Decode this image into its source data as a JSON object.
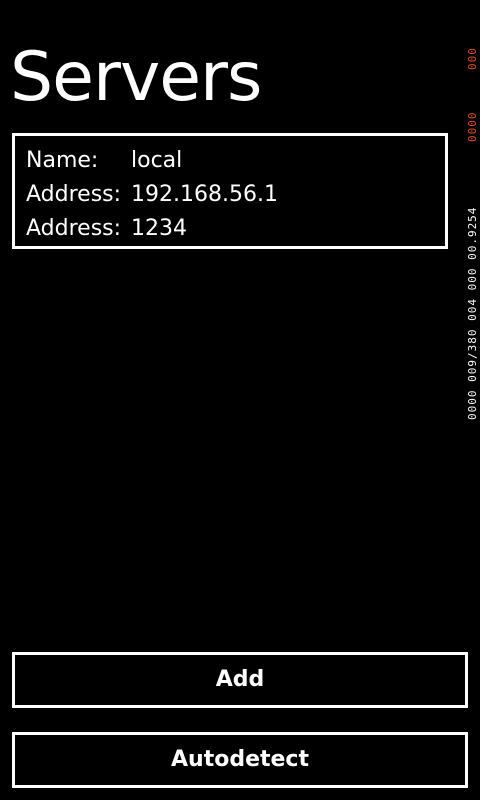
{
  "header": {
    "title": "Servers"
  },
  "servers": [
    {
      "rows": [
        {
          "label": "Name:",
          "value": "local"
        },
        {
          "label": "Address:",
          "value": "192.168.56.1"
        },
        {
          "label": "Address:",
          "value": "1234"
        }
      ]
    }
  ],
  "actions": {
    "add_label": "Add",
    "autodetect_label": "Autodetect"
  },
  "debug_counters": {
    "segment_1": "000",
    "segment_2": "0000",
    "segment_3": "0000 009/380 004 000 00.9254"
  },
  "colors": {
    "background": "#000000",
    "foreground": "#ffffff",
    "counter_accent": "#e8501e"
  }
}
